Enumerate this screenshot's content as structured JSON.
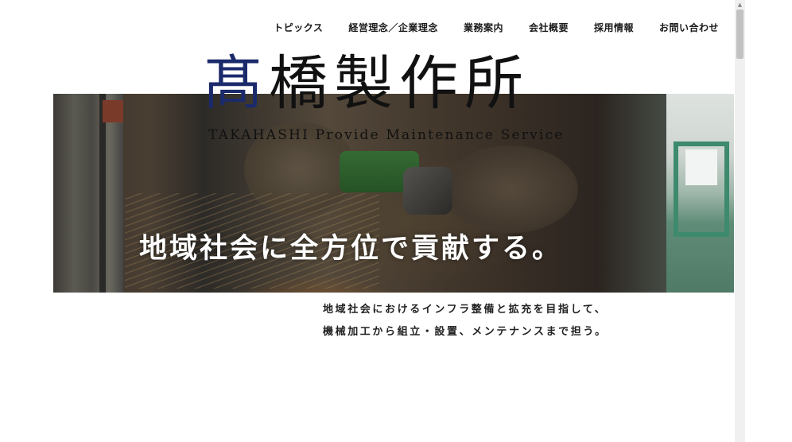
{
  "nav": {
    "items": [
      {
        "label": "トピックス"
      },
      {
        "label": "経営理念／企業理念"
      },
      {
        "label": "業務案内"
      },
      {
        "label": "会社概要"
      },
      {
        "label": "採用情報"
      },
      {
        "label": "お問い合わせ"
      }
    ]
  },
  "logo": {
    "kanji_first": "髙",
    "kanji_rest": "橋製作所",
    "subtitle": "TAKAHASHI Provide Maintenance Service",
    "accent_color": "#1b2a6b"
  },
  "hero": {
    "tagline": "地域社会に全方位で貢献する。"
  },
  "intro": {
    "line1": "地域社会におけるインフラ整備と拡充を目指して、",
    "line2": "機械加工から組立・設置、メンテナンスまで担う。"
  },
  "scrollbar": {
    "up_arrow_icon": "▲"
  }
}
